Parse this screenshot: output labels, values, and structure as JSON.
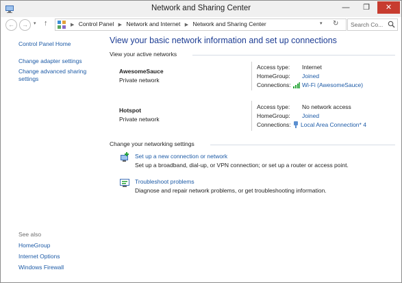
{
  "window": {
    "title": "Network and Sharing Center",
    "minimize_glyph": "—",
    "maximize_glyph": "❐",
    "close_glyph": "✕"
  },
  "nav": {
    "back_glyph": "←",
    "forward_glyph": "→",
    "up_glyph": "↑",
    "recent_glyph": "▾",
    "breadcrumbs": [
      "Control Panel",
      "Network and Internet",
      "Network and Sharing Center"
    ],
    "search_placeholder": "Search Co..."
  },
  "sidebar": {
    "home": "Control Panel Home",
    "links": [
      "Change adapter settings",
      "Change advanced sharing settings"
    ],
    "see_also_title": "See also",
    "see_also": [
      "HomeGroup",
      "Internet Options",
      "Windows Firewall"
    ]
  },
  "main": {
    "heading": "View your basic network information and set up connections",
    "active_title": "View your active networks",
    "networks": [
      {
        "name": "AwesomeSauce",
        "type": "Private network",
        "access_label": "Access type:",
        "access_value": "Internet",
        "homegroup_label": "HomeGroup:",
        "homegroup_value": "Joined",
        "connections_label": "Connections:",
        "connection": "Wi-Fi (AwesomeSauce)",
        "connection_icon": "wifi-signal-icon"
      },
      {
        "name": "Hotspot",
        "type": "Private network",
        "access_label": "Access type:",
        "access_value": "No network access",
        "homegroup_label": "HomeGroup:",
        "homegroup_value": "Joined",
        "connections_label": "Connections:",
        "connection": "Local Area Connection* 4",
        "connection_icon": "ethernet-icon"
      }
    ],
    "change_title": "Change your networking settings",
    "tasks": [
      {
        "link": "Set up a new connection or network",
        "desc": "Set up a broadband, dial-up, or VPN connection; or set up a router or access point.",
        "icon": "new-connection-icon"
      },
      {
        "link": "Troubleshoot problems",
        "desc": "Diagnose and repair network problems, or get troubleshooting information.",
        "icon": "troubleshoot-icon"
      }
    ]
  },
  "colors": {
    "link": "#1c5aa6",
    "heading": "#1c3c93",
    "close_button": "#c73c2f"
  }
}
